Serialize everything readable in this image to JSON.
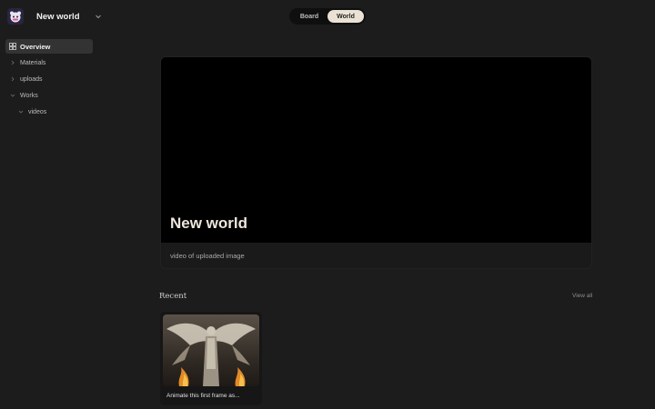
{
  "workspace": {
    "title": "New world",
    "icon": "app-logo-icon"
  },
  "view_toggle": {
    "options": [
      "Board",
      "World"
    ],
    "active": "World"
  },
  "sidebar": {
    "overview_label": "Overview",
    "items": [
      {
        "label": "Materials",
        "level": 1
      },
      {
        "label": "uploads",
        "level": 1
      },
      {
        "label": "Works",
        "level": 1
      },
      {
        "label": "videos",
        "level": 2
      }
    ]
  },
  "hero": {
    "title": "New world",
    "description": "video of uploaded image"
  },
  "recent": {
    "heading": "Recent",
    "view_all_label": "View all",
    "cards": [
      {
        "caption": "Animate this first frame as..."
      }
    ]
  },
  "colors": {
    "background": "#1c1c1c",
    "toggle_active": "#eae3d5",
    "sidebar_active": "#333333",
    "hero_media": "#000000"
  }
}
